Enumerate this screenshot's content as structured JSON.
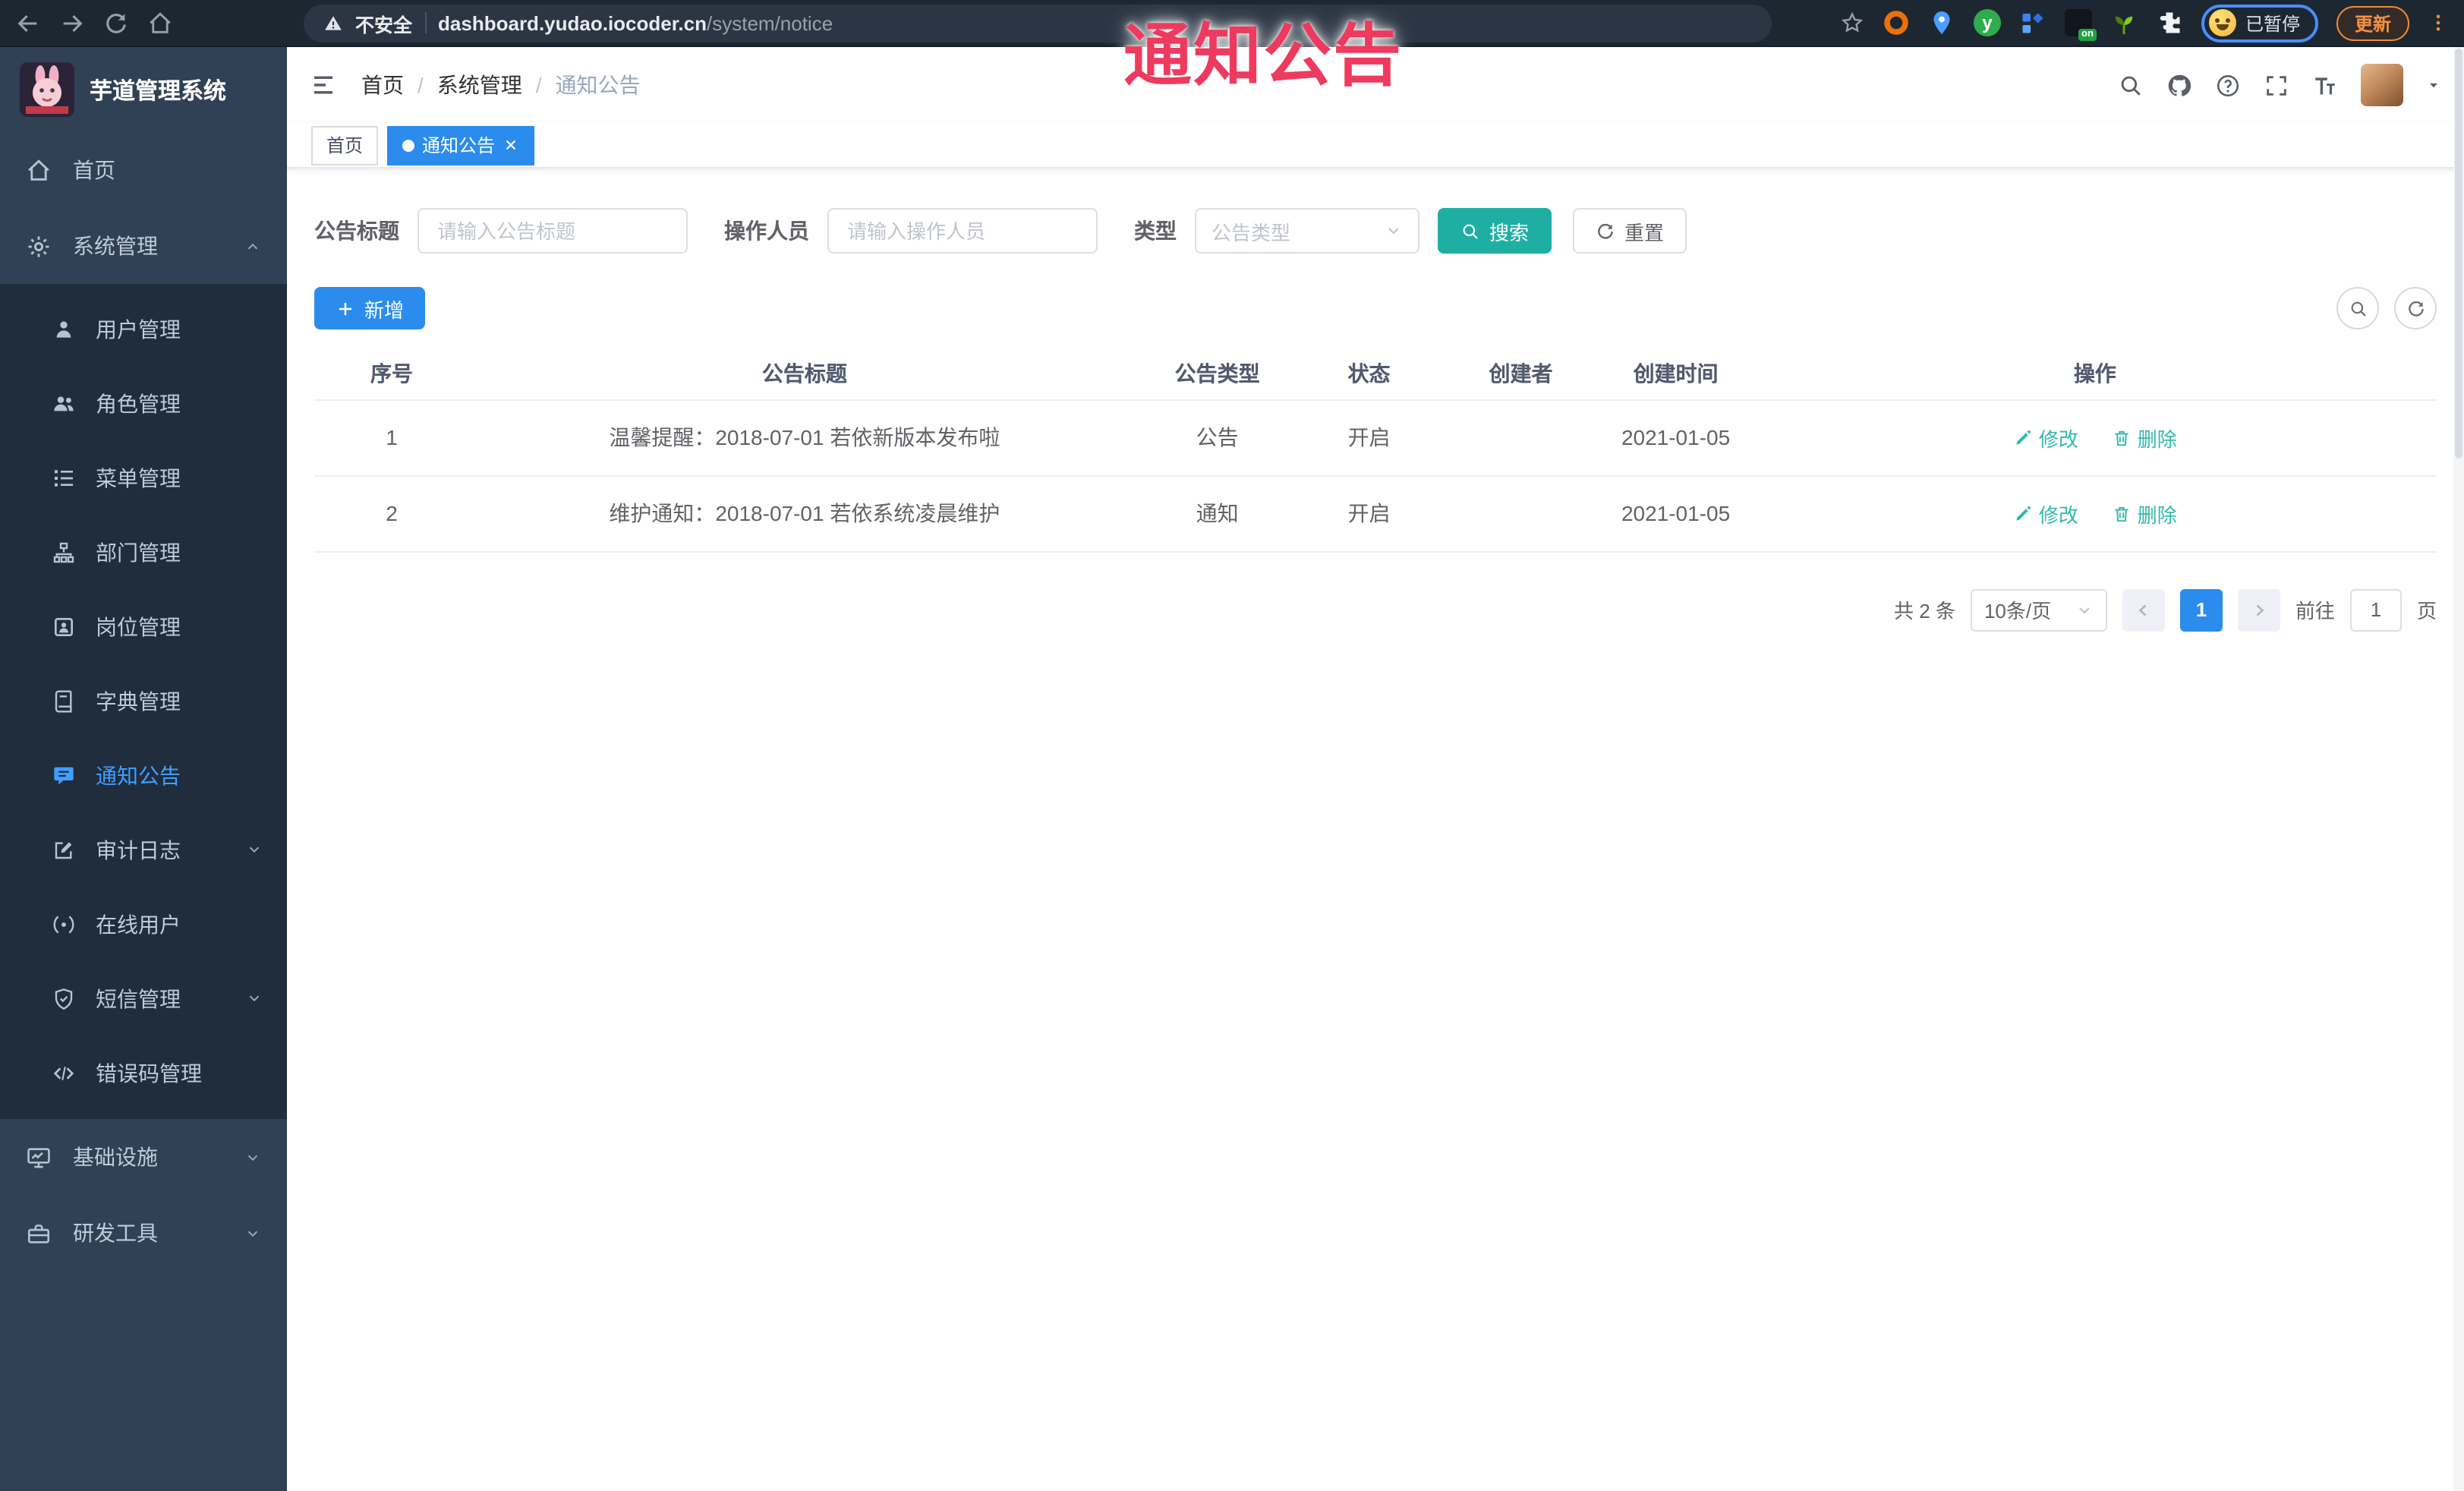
{
  "colors": {
    "accent_blue": "#2b8ced",
    "teal_button": "#1fafa2",
    "teal_link": "#33b9ad",
    "sidebar_bg": "#304156",
    "submenu_bg": "#1f2d3d",
    "active_menu_text": "#409eff",
    "watermark_red": "#ee3a5e",
    "browser_bar_bg": "#1d2732",
    "update_orange": "#ef8b31",
    "profile_ring_blue": "#4b8df8"
  },
  "watermark": "通知公告",
  "browser": {
    "warning_label": "不安全",
    "url_host": "dashboard.yudao.iocoder.cn",
    "url_path": "/system/notice",
    "extension_badge": "on",
    "extension_letter": "y",
    "profile_label": "已暂停",
    "update_label": "更新"
  },
  "sidebar": {
    "app_title": "芋道管理系统",
    "items": [
      {
        "label": "首页"
      },
      {
        "label": "系统管理"
      },
      {
        "label": "基础设施"
      },
      {
        "label": "研发工具"
      }
    ],
    "system_children": [
      {
        "label": "用户管理"
      },
      {
        "label": "角色管理"
      },
      {
        "label": "菜单管理"
      },
      {
        "label": "部门管理"
      },
      {
        "label": "岗位管理"
      },
      {
        "label": "字典管理"
      },
      {
        "label": "通知公告"
      },
      {
        "label": "审计日志"
      },
      {
        "label": "在线用户"
      },
      {
        "label": "短信管理"
      },
      {
        "label": "错误码管理"
      }
    ]
  },
  "header": {
    "breadcrumb": [
      "首页",
      "系统管理",
      "通知公告"
    ]
  },
  "tabs": [
    {
      "label": "首页",
      "active": false
    },
    {
      "label": "通知公告",
      "active": true
    }
  ],
  "filters": {
    "title_label": "公告标题",
    "title_placeholder": "请输入公告标题",
    "operator_label": "操作人员",
    "operator_placeholder": "请输入操作人员",
    "type_label": "类型",
    "type_placeholder": "公告类型",
    "search_label": "搜索",
    "reset_label": "重置"
  },
  "toolbar": {
    "add_label": "新增"
  },
  "table": {
    "columns": [
      "序号",
      "公告标题",
      "公告类型",
      "状态",
      "创建者",
      "创建时间",
      "操作"
    ],
    "rows": [
      {
        "no": "1",
        "title": "温馨提醒：2018-07-01 若依新版本发布啦",
        "type": "公告",
        "status": "开启",
        "creator": "",
        "created": "2021-01-05",
        "edit": "修改",
        "delete": "删除"
      },
      {
        "no": "2",
        "title": "维护通知：2018-07-01 若依系统凌晨维护",
        "type": "通知",
        "status": "开启",
        "creator": "",
        "created": "2021-01-05",
        "edit": "修改",
        "delete": "删除"
      }
    ]
  },
  "pagination": {
    "total": "共 2 条",
    "page_size": "10条/页",
    "page": "1",
    "goto_label": "前往",
    "goto_value": "1",
    "page_unit": "页"
  }
}
